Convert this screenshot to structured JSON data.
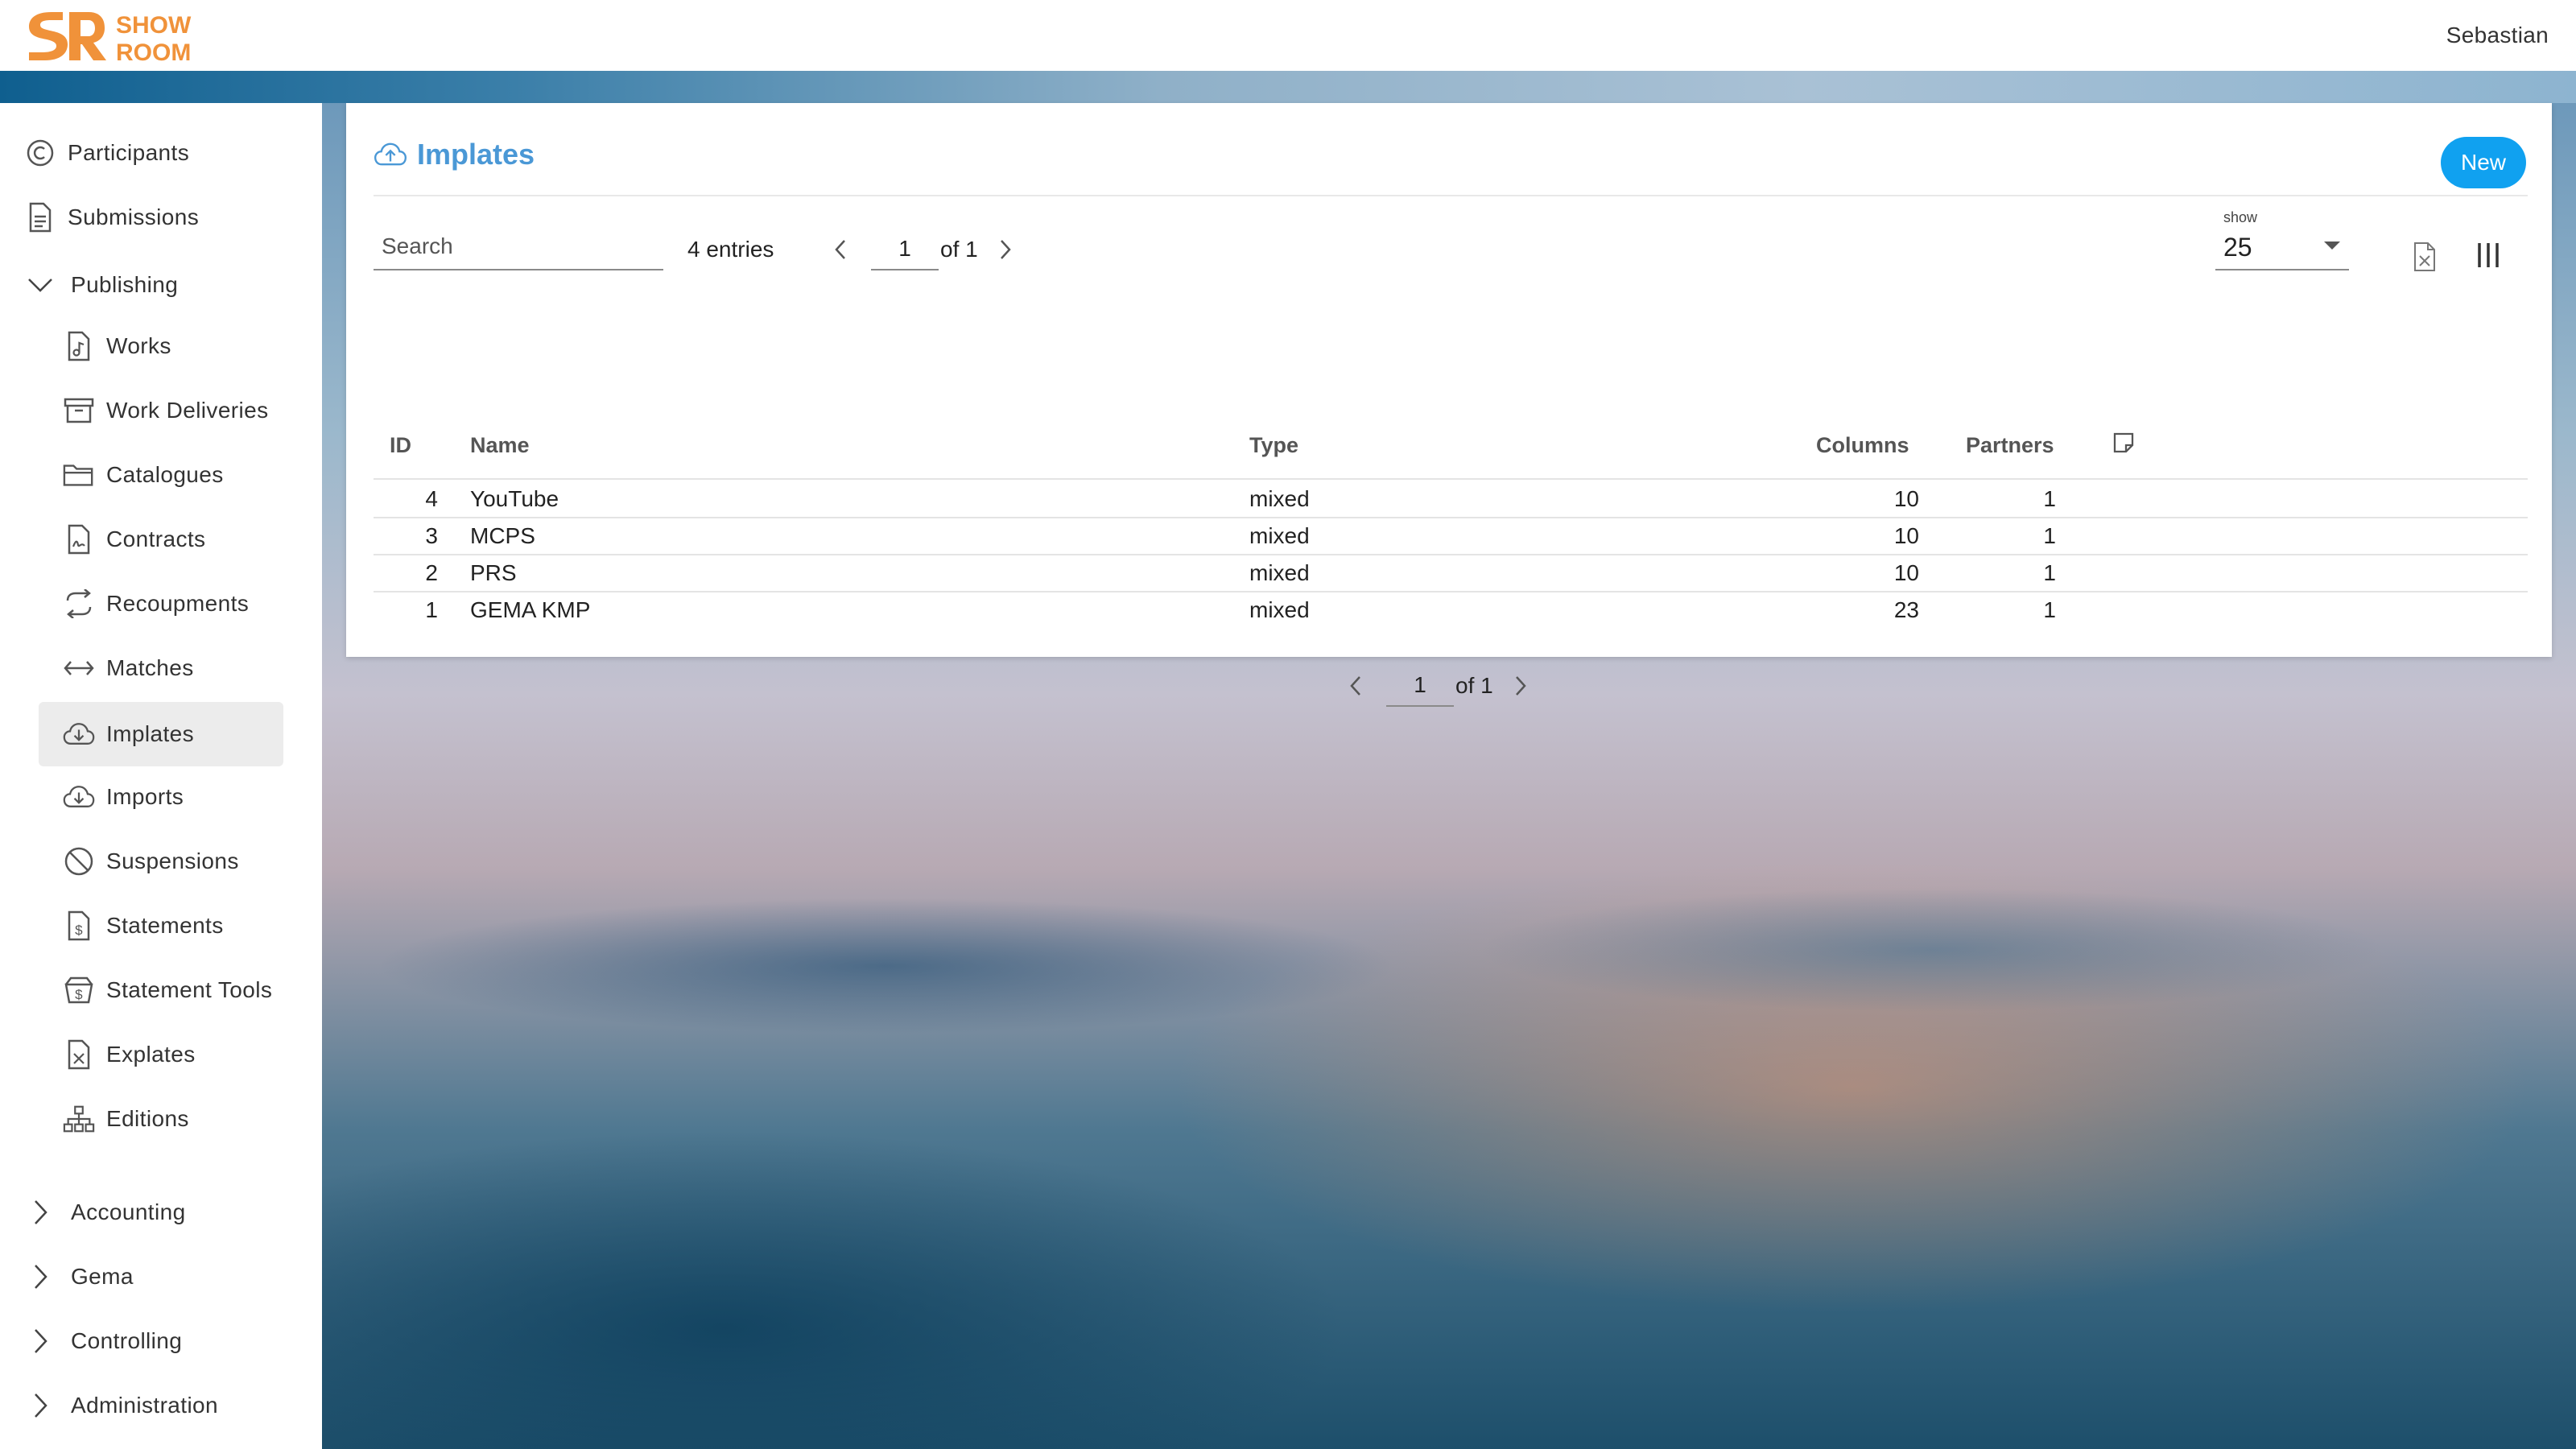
{
  "header": {
    "logo_text": "SR SHOW ROOM",
    "user": "Sebastian"
  },
  "sidebar": {
    "top_items": [
      {
        "label": "Participants",
        "icon": "copyright-icon"
      },
      {
        "label": "Submissions",
        "icon": "document-icon"
      }
    ],
    "publishing": {
      "label": "Publishing",
      "expanded": true,
      "items": [
        {
          "label": "Works",
          "icon": "music-file-icon"
        },
        {
          "label": "Work Deliveries",
          "icon": "archive-box-icon"
        },
        {
          "label": "Catalogues",
          "icon": "folder-icon"
        },
        {
          "label": "Contracts",
          "icon": "contract-icon"
        },
        {
          "label": "Recoupments",
          "icon": "cycle-arrows-icon"
        },
        {
          "label": "Matches",
          "icon": "double-arrow-icon"
        },
        {
          "label": "Implates",
          "icon": "cloud-download-icon",
          "active": true
        },
        {
          "label": "Imports",
          "icon": "cloud-download-icon"
        },
        {
          "label": "Suspensions",
          "icon": "block-icon"
        },
        {
          "label": "Statements",
          "icon": "dollar-file-icon"
        },
        {
          "label": "Statement Tools",
          "icon": "dollar-tools-icon"
        },
        {
          "label": "Explates",
          "icon": "excel-file-icon"
        },
        {
          "label": "Editions",
          "icon": "hierarchy-icon"
        }
      ]
    },
    "collapsed_sections": [
      {
        "label": "Accounting"
      },
      {
        "label": "Gema"
      },
      {
        "label": "Controlling"
      },
      {
        "label": "Administration"
      }
    ]
  },
  "page": {
    "title": "Implates",
    "new_button": "New",
    "search_placeholder": "Search",
    "entries_text": "4 entries",
    "pager": {
      "page": "1",
      "of_text": "of 1"
    },
    "show": {
      "label": "show",
      "value": "25"
    },
    "table": {
      "columns": [
        "ID",
        "Name",
        "Type",
        "Columns",
        "Partners"
      ],
      "rows": [
        {
          "id": "4",
          "name": "YouTube",
          "type": "mixed",
          "columns": "10",
          "partners": "1"
        },
        {
          "id": "3",
          "name": "MCPS",
          "type": "mixed",
          "columns": "10",
          "partners": "1"
        },
        {
          "id": "2",
          "name": "PRS",
          "type": "mixed",
          "columns": "10",
          "partners": "1"
        },
        {
          "id": "1",
          "name": "GEMA KMP",
          "type": "mixed",
          "columns": "23",
          "partners": "1"
        }
      ]
    }
  },
  "colors": {
    "accent": "#10a1f0",
    "title": "#4a98d6",
    "logo_orange": "#f0923a",
    "active_bg": "#ececec"
  }
}
